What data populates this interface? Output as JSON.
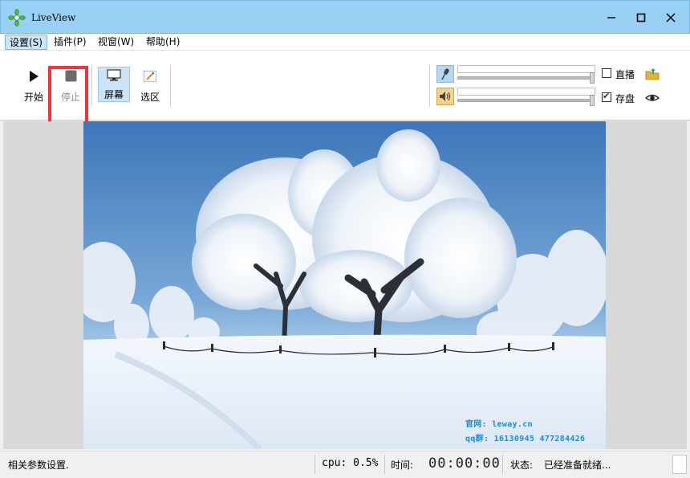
{
  "window": {
    "title": "LiveView"
  },
  "menu": [
    {
      "label": "设置(S)",
      "active": true
    },
    {
      "label": "插件(P)"
    },
    {
      "label": "视窗(W)"
    },
    {
      "label": "帮助(H)"
    }
  ],
  "toolbar": {
    "start_label": "开始",
    "stop_label": "停止",
    "screen_label": "屏幕",
    "region_label": "选区",
    "live_label": "直播",
    "live_checked": false,
    "save_label": "存盘",
    "save_checked": true,
    "mic_level": 1.0,
    "speaker_level": 1.0
  },
  "preview": {
    "watermark_site": "官网: leway.cn",
    "watermark_qq": "qq群: 16130945  477284426"
  },
  "status": {
    "hint": "相关参数设置.",
    "cpu": "cpu: 0.5%",
    "time_label": "时间:",
    "time_value": "00:00:00",
    "state_label": "状态:",
    "state_value": "已经准备就绪..."
  },
  "colors": {
    "titlebar": "#99d1f5",
    "highlight": "#f3343d",
    "accent": "#1d8bd6"
  },
  "icons": [
    "app-logo-icon",
    "minimize-icon",
    "maximize-icon",
    "close-icon",
    "play-icon",
    "stop-icon",
    "monitor-icon",
    "region-select-icon",
    "microphone-icon",
    "speaker-icon",
    "folder-upload-icon",
    "eye-icon"
  ]
}
